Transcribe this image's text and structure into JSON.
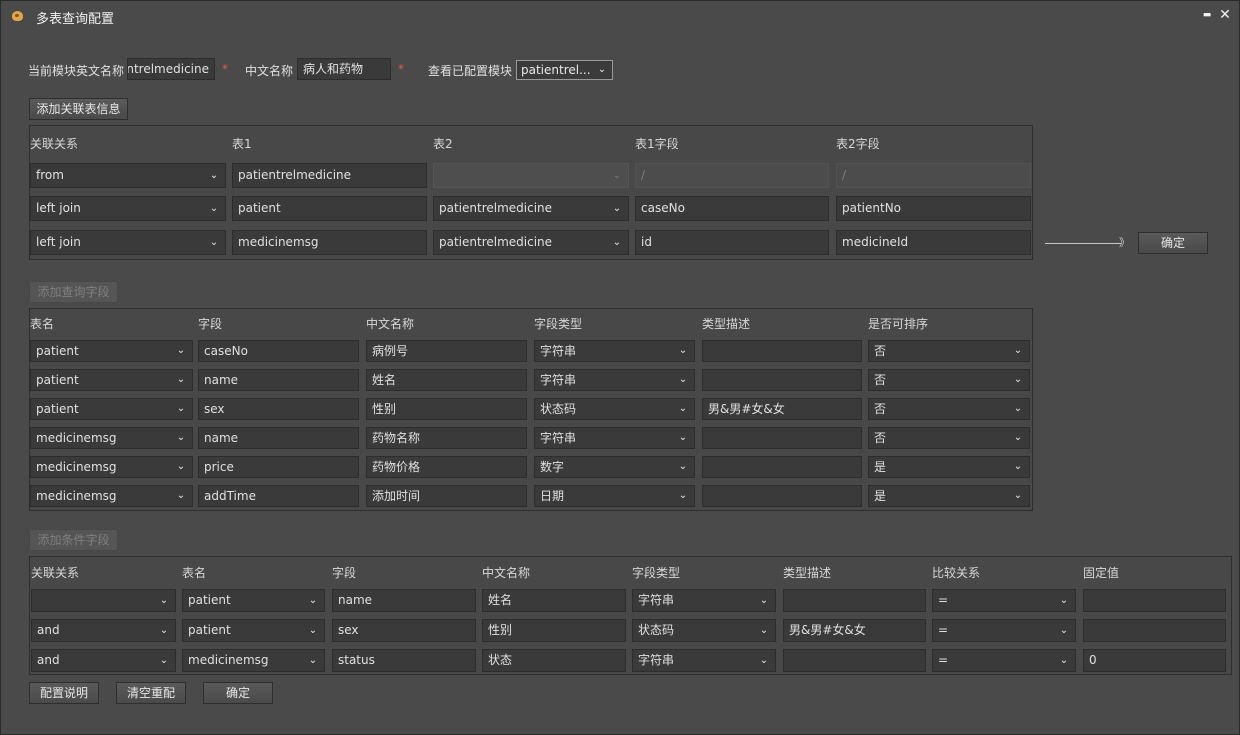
{
  "window": {
    "title": "多表查询配置"
  },
  "top": {
    "en_label": "当前模块英文名称",
    "en_value": "patientrelmedicine",
    "cn_label": "中文名称",
    "cn_value": "病人和药物",
    "view_label": "查看已配置模块",
    "view_value": "patientrel...",
    "required_mark": "*"
  },
  "join": {
    "add_button": "添加关联表信息",
    "headers": [
      "关联关系",
      "表1",
      "表2",
      "表1字段",
      "表2字段"
    ],
    "rows": [
      {
        "rel": "from",
        "t1": "patientrelmedicine",
        "t2": "",
        "f1": "/",
        "f2": "/"
      },
      {
        "rel": "left join",
        "t1": "patient",
        "t2": "patientrelmedicine",
        "f1": "caseNo",
        "f2": "patientNo"
      },
      {
        "rel": "left join",
        "t1": "medicinemsg",
        "t2": "patientrelmedicine",
        "f1": "id",
        "f2": "medicineId"
      }
    ],
    "confirm_arrow": "》",
    "confirm_button": "确定"
  },
  "query": {
    "add_button": "添加查询字段",
    "headers": [
      "表名",
      "字段",
      "中文名称",
      "字段类型",
      "类型描述",
      "是否可排序"
    ],
    "rows": [
      {
        "table": "patient",
        "field": "caseNo",
        "cn": "病例号",
        "type": "字符串",
        "desc": "",
        "sort": "否"
      },
      {
        "table": "patient",
        "field": "name",
        "cn": "姓名",
        "type": "字符串",
        "desc": "",
        "sort": "否"
      },
      {
        "table": "patient",
        "field": "sex",
        "cn": "性别",
        "type": "状态码",
        "desc": "男&男#女&女",
        "sort": "否"
      },
      {
        "table": "medicinemsg",
        "field": "name",
        "cn": "药物名称",
        "type": "字符串",
        "desc": "",
        "sort": "否"
      },
      {
        "table": "medicinemsg",
        "field": "price",
        "cn": "药物价格",
        "type": "数字",
        "desc": "",
        "sort": "是"
      },
      {
        "table": "medicinemsg",
        "field": "addTime",
        "cn": "添加时间",
        "type": "日期",
        "desc": "",
        "sort": "是"
      }
    ]
  },
  "cond": {
    "add_button": "添加条件字段",
    "headers": [
      "关联关系",
      "表名",
      "字段",
      "中文名称",
      "字段类型",
      "类型描述",
      "比较关系",
      "固定值"
    ],
    "rows": [
      {
        "rel": "",
        "table": "patient",
        "field": "name",
        "cn": "姓名",
        "type": "字符串",
        "desc": "",
        "cmp": "=",
        "val": ""
      },
      {
        "rel": "and",
        "table": "patient",
        "field": "sex",
        "cn": "性别",
        "type": "状态码",
        "desc": "男&男#女&女",
        "cmp": "=",
        "val": ""
      },
      {
        "rel": "and",
        "table": "medicinemsg",
        "field": "status",
        "cn": "状态",
        "type": "字符串",
        "desc": "",
        "cmp": "=",
        "val": "0"
      }
    ]
  },
  "footer": {
    "config_help": "配置说明",
    "reset": "清空重配",
    "confirm": "确定"
  },
  "icons": {
    "caret": "⌄",
    "minimize": "▬",
    "close": "✕"
  }
}
